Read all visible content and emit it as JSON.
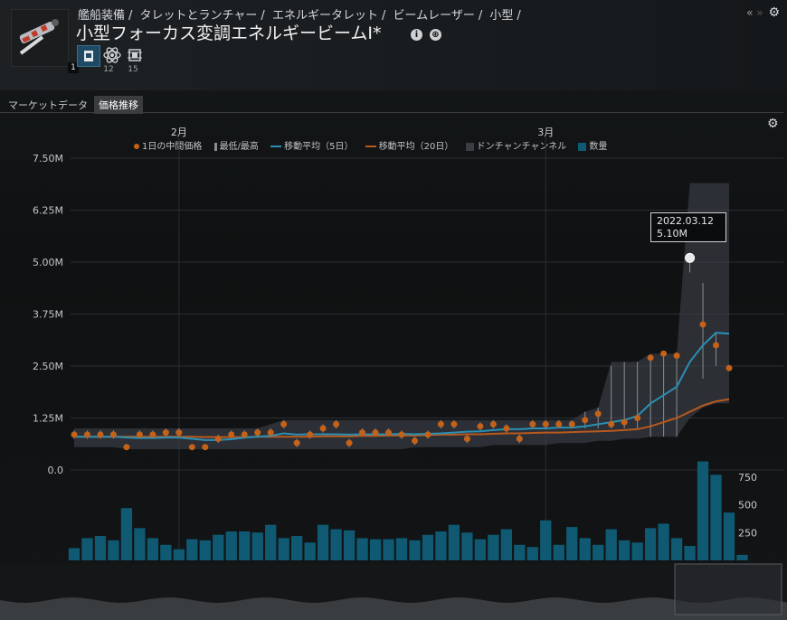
{
  "breadcrumb": [
    "艦船装備",
    "タレットとランチャー",
    "エネルギータレット",
    "ビームレーザー",
    "小型"
  ],
  "title": "小型フォーカス変調エネルギービームI",
  "title_suffix": "*",
  "item_meta_level": "1",
  "attributes": [
    {
      "icon": "blueprint-icon",
      "count": ""
    },
    {
      "icon": "atom-icon",
      "count": "12"
    },
    {
      "icon": "chip-icon",
      "count": "15"
    }
  ],
  "window_controls": {
    "collapse": "«",
    "expand": "»"
  },
  "tabs": [
    {
      "label": "マーケットデータ",
      "active": false
    },
    {
      "label": "価格推移",
      "active": true
    }
  ],
  "legend": [
    {
      "label": "1日の中間価格",
      "color": "#c4621a",
      "kind": "dot"
    },
    {
      "label": "最低/最高",
      "color": "#8a8d90",
      "kind": "bar"
    },
    {
      "label": "移動平均（5日）",
      "color": "#2a8fb5",
      "kind": "line"
    },
    {
      "label": "移動平均（20日）",
      "color": "#b85a1e",
      "kind": "line"
    },
    {
      "label": "ドンチャンチャンネル",
      "color": "#3a3d44",
      "kind": "box"
    },
    {
      "label": "数量",
      "color": "#0f5a72",
      "kind": "box"
    }
  ],
  "tooltip": {
    "date": "2022.03.12",
    "value": "5.10M"
  },
  "chart_data": {
    "type": "line",
    "months": [
      {
        "label": "2月",
        "index": 8
      },
      {
        "label": "3月",
        "index": 36
      }
    ],
    "y_ticks": [
      "7.50M",
      "6.25M",
      "5.00M",
      "3.75M",
      "2.50M",
      "1.25M",
      "0.0"
    ],
    "y_range": [
      0,
      7.5
    ],
    "volume_ticks": [
      "750",
      "500",
      "250"
    ],
    "volume_range": [
      0,
      1000
    ],
    "mid_price": [
      0.85,
      0.85,
      0.85,
      0.85,
      0.55,
      0.85,
      0.85,
      0.9,
      0.9,
      0.55,
      0.55,
      0.75,
      0.85,
      0.85,
      0.9,
      0.9,
      1.1,
      0.65,
      0.85,
      1.0,
      1.1,
      0.65,
      0.9,
      0.9,
      0.9,
      0.85,
      0.7,
      0.85,
      1.1,
      1.1,
      0.75,
      1.05,
      1.1,
      1.0,
      0.75,
      1.1,
      1.1,
      1.1,
      1.1,
      1.2,
      1.35,
      1.1,
      1.15,
      1.25,
      2.7,
      2.8,
      2.75,
      5.1,
      3.5,
      3.0,
      2.45
    ],
    "low": [
      0.75,
      0.75,
      0.75,
      0.75,
      0.5,
      0.75,
      0.75,
      0.8,
      0.8,
      0.5,
      0.5,
      0.65,
      0.75,
      0.75,
      0.8,
      0.8,
      1.0,
      0.55,
      0.75,
      0.9,
      1.0,
      0.55,
      0.8,
      0.8,
      0.8,
      0.75,
      0.6,
      0.75,
      1.0,
      1.0,
      0.65,
      0.95,
      1.0,
      0.9,
      0.65,
      1.0,
      1.0,
      1.0,
      1.0,
      1.0,
      1.0,
      1.0,
      1.0,
      1.0,
      0.8,
      0.8,
      0.8,
      4.75,
      2.2,
      2.5,
      2.45
    ],
    "high": [
      0.95,
      0.95,
      0.95,
      0.95,
      0.6,
      0.95,
      0.95,
      1.0,
      1.0,
      0.6,
      0.6,
      0.85,
      0.95,
      0.95,
      1.0,
      1.0,
      1.2,
      0.75,
      0.95,
      1.1,
      1.2,
      0.75,
      1.0,
      1.0,
      1.0,
      0.95,
      0.8,
      0.95,
      1.2,
      1.2,
      0.85,
      1.15,
      1.2,
      1.1,
      0.85,
      1.2,
      1.2,
      1.2,
      1.2,
      1.4,
      1.5,
      2.5,
      2.6,
      2.6,
      2.7,
      2.8,
      2.8,
      5.2,
      4.5,
      3.3,
      2.5
    ],
    "ma5": [
      0.8,
      0.8,
      0.8,
      0.8,
      0.78,
      0.77,
      0.77,
      0.78,
      0.78,
      0.75,
      0.72,
      0.72,
      0.74,
      0.78,
      0.8,
      0.82,
      0.88,
      0.85,
      0.86,
      0.86,
      0.86,
      0.85,
      0.86,
      0.86,
      0.86,
      0.87,
      0.86,
      0.87,
      0.88,
      0.9,
      0.92,
      0.93,
      0.96,
      0.98,
      0.98,
      1.0,
      1.0,
      1.02,
      1.02,
      1.05,
      1.1,
      1.15,
      1.2,
      1.3,
      1.6,
      1.8,
      2.0,
      2.6,
      3.0,
      3.3,
      3.28
    ],
    "ma20": [
      0.8,
      0.8,
      0.8,
      0.8,
      0.8,
      0.8,
      0.8,
      0.8,
      0.8,
      0.8,
      0.79,
      0.79,
      0.79,
      0.79,
      0.8,
      0.8,
      0.8,
      0.8,
      0.8,
      0.81,
      0.81,
      0.81,
      0.82,
      0.82,
      0.83,
      0.83,
      0.83,
      0.84,
      0.85,
      0.85,
      0.86,
      0.86,
      0.87,
      0.88,
      0.88,
      0.89,
      0.9,
      0.9,
      0.91,
      0.92,
      0.93,
      0.94,
      0.96,
      0.98,
      1.05,
      1.15,
      1.25,
      1.4,
      1.55,
      1.65,
      1.7
    ],
    "donchian_low": [
      0.55,
      0.55,
      0.55,
      0.55,
      0.5,
      0.5,
      0.5,
      0.5,
      0.5,
      0.5,
      0.5,
      0.5,
      0.5,
      0.5,
      0.5,
      0.5,
      0.5,
      0.5,
      0.5,
      0.5,
      0.5,
      0.5,
      0.5,
      0.5,
      0.5,
      0.5,
      0.55,
      0.55,
      0.55,
      0.55,
      0.55,
      0.55,
      0.6,
      0.6,
      0.6,
      0.6,
      0.6,
      0.65,
      0.65,
      0.65,
      0.7,
      0.7,
      0.75,
      0.75,
      0.8,
      0.8,
      0.8,
      1.25,
      1.5,
      1.6,
      1.6
    ],
    "donchian_high": [
      1.0,
      1.0,
      1.0,
      1.0,
      1.0,
      1.0,
      1.0,
      1.0,
      1.0,
      1.0,
      1.0,
      1.0,
      1.0,
      1.0,
      1.0,
      1.1,
      1.2,
      1.2,
      1.2,
      1.2,
      1.2,
      1.2,
      1.2,
      1.2,
      1.2,
      1.2,
      1.2,
      1.2,
      1.2,
      1.2,
      1.2,
      1.2,
      1.2,
      1.2,
      1.2,
      1.2,
      1.2,
      1.2,
      1.2,
      1.4,
      1.5,
      2.6,
      2.6,
      2.6,
      2.8,
      2.8,
      2.8,
      6.9,
      6.9,
      6.9,
      6.9
    ],
    "volume": [
      110,
      200,
      220,
      180,
      470,
      290,
      200,
      140,
      100,
      190,
      180,
      230,
      260,
      260,
      250,
      320,
      200,
      220,
      160,
      320,
      280,
      270,
      200,
      190,
      190,
      200,
      180,
      230,
      260,
      320,
      250,
      190,
      230,
      280,
      140,
      120,
      360,
      140,
      300,
      200,
      140,
      280,
      180,
      160,
      290,
      330,
      200,
      130,
      890,
      770,
      430,
      50
    ]
  }
}
